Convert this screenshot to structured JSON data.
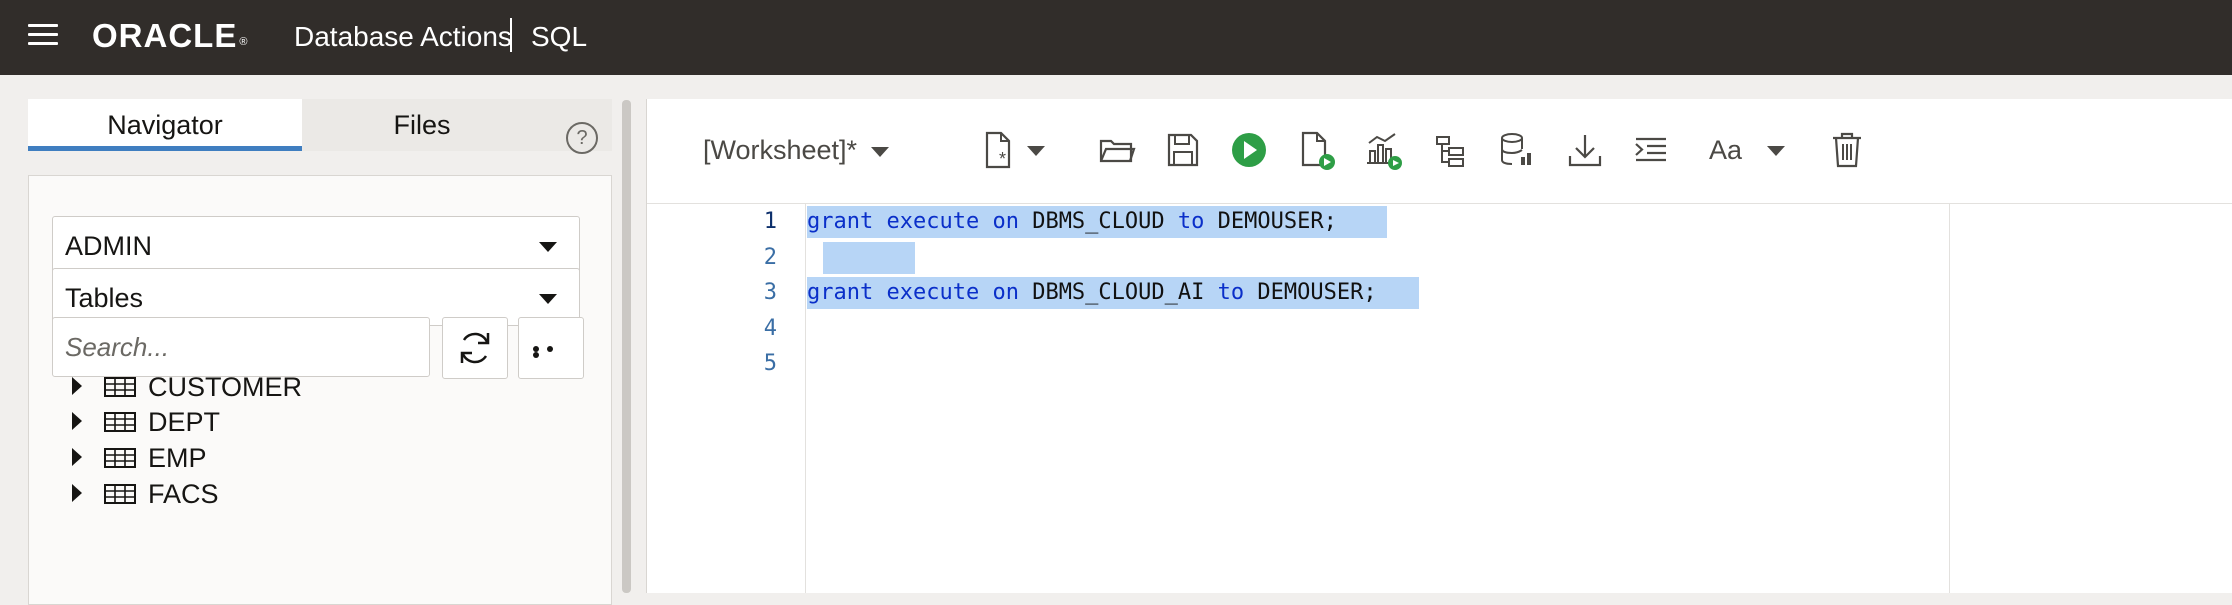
{
  "header": {
    "logo": "ORACLE",
    "product": "Database Actions",
    "module": "SQL"
  },
  "navigator": {
    "tabs": [
      "Navigator",
      "Files"
    ],
    "active_tab": "Navigator",
    "help_glyph": "?",
    "schema": "ADMIN",
    "object_type": "Tables",
    "search": {
      "value": "",
      "placeholder": "Search..."
    },
    "tables": [
      "CUSTOMER",
      "DEPT",
      "EMP",
      "FACS"
    ]
  },
  "worksheet": {
    "title": "[Worksheet]*",
    "toolbar_icons": [
      "new-worksheet-icon",
      "open-file-icon",
      "save-icon",
      "run-statement-icon",
      "run-script-icon",
      "autotrace-icon",
      "explain-plan-icon",
      "sql-tuning-icon",
      "download-icon",
      "format-icon",
      "font-size-icon",
      "clear-icon"
    ],
    "font_label": "Aa",
    "line_numbers": [
      "1",
      "2",
      "3",
      "4",
      "5"
    ],
    "lines": [
      [
        {
          "t": "grant",
          "k": true
        },
        {
          "t": " "
        },
        {
          "t": "execute",
          "k": true
        },
        {
          "t": " "
        },
        {
          "t": "on",
          "k": true
        },
        {
          "t": " DBMS_CLOUD "
        },
        {
          "t": "to",
          "k": true
        },
        {
          "t": " DEMOUSER;"
        }
      ],
      [],
      [
        {
          "t": "grant",
          "k": true
        },
        {
          "t": " "
        },
        {
          "t": "execute",
          "k": true
        },
        {
          "t": " "
        },
        {
          "t": "on",
          "k": true
        },
        {
          "t": " DBMS_CLOUD_AI "
        },
        {
          "t": "to",
          "k": true
        },
        {
          "t": " DEMOUSER;"
        }
      ],
      [],
      []
    ]
  },
  "colors": {
    "header_bg": "#312d2a",
    "tab_accent": "#3f7ec0",
    "run_green": "#2e9e46",
    "keyword": "#0a2fc9",
    "selection": "#b7d5f6"
  }
}
